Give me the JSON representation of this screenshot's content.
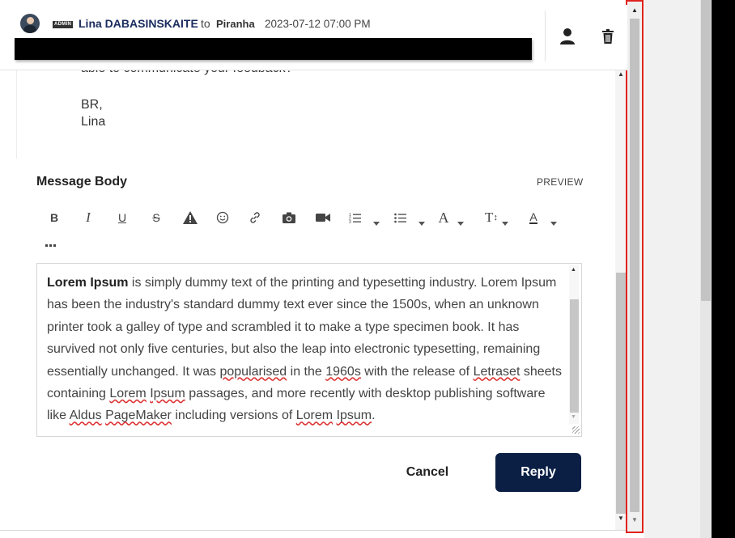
{
  "header": {
    "admin_badge": "ADMIN",
    "author": "Lina DABASINSKAITE",
    "to_word": "to",
    "recipient": "Piranha",
    "timestamp": "2023-07-12 07:00 PM"
  },
  "previous_message": {
    "cut_line": "able to communicate your feedback?",
    "signoff": "BR,",
    "name": "Lina"
  },
  "composer": {
    "title": "Message Body",
    "preview_label": "PREVIEW",
    "toolbar": [
      "bold-icon",
      "italic-icon",
      "underline-icon",
      "strikethrough-icon",
      "warning-icon",
      "emoji-icon",
      "link-icon",
      "camera-icon",
      "video-icon",
      "ordered-list-icon",
      "bullet-list-icon",
      "font-family-icon",
      "font-size-icon",
      "text-color-icon",
      "more-icon"
    ],
    "body": {
      "bold_lead": "Lorem Ipsum",
      "p1": " is simply dummy text of the printing and typesetting industry. Lorem Ipsum has been the industry's standard dummy text ever since the 1500s, when an unknown printer took a galley of type and scrambled it to make a type specimen book. It has survived not only five centuries, but also the leap into electronic typesetting, remaining essentially unchanged. It was ",
      "w_popularised": "popularised",
      "p2": " in the ",
      "w_1960s": "1960s",
      "p3": " with the release of ",
      "w_letraset": "Letraset",
      "p4": " sheets containing ",
      "w_lorem1": "Lorem",
      "p5": " ",
      "w_ipsum1": "Ipsum",
      "p6": " passages, and more recently with desktop publishing software like ",
      "w_aldus": "Aldus",
      "p7": " ",
      "w_pagemaker": "PageMaker",
      "p8": " including versions of ",
      "w_lorem2": "Lorem",
      "p9": " ",
      "w_ipsum2": "Ipsum",
      "p10": "."
    },
    "cancel_label": "Cancel",
    "reply_label": "Reply"
  },
  "colors": {
    "reply_button": "#0b1f45",
    "author_name": "#1a2b5e",
    "highlight_border": "#e0211c"
  }
}
